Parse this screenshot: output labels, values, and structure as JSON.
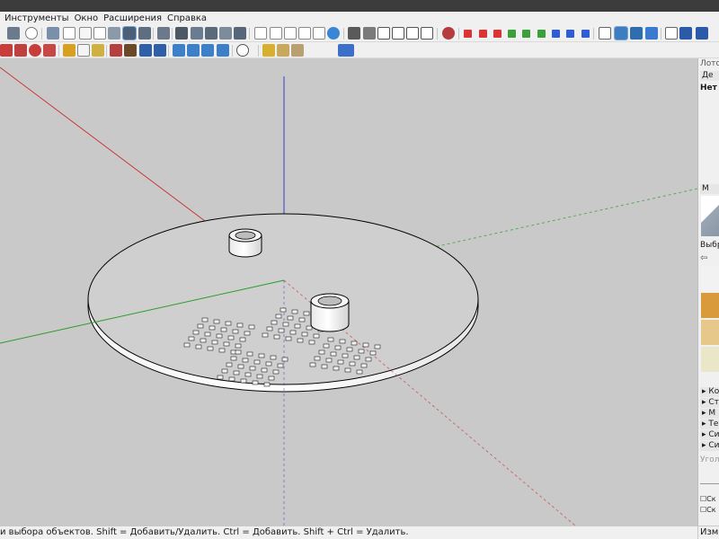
{
  "menu": [
    "Инструменты",
    "Окно",
    "Расширения",
    "Справка"
  ],
  "tray": {
    "title": "Лоток",
    "entity_info_header": "Де",
    "entity_info_value": "Нет",
    "materials_header": "М",
    "select_tab": "Выбра",
    "collapsed_panels": [
      "Ко",
      "Ст",
      "М",
      "Те",
      "Си",
      "Си"
    ],
    "angle_label": "Угол",
    "checkbox_labels": [
      "Ск",
      "Ск"
    ]
  },
  "materials": {
    "swatch_colors": [
      "#f2f2f2",
      "#d89a3a",
      "#e6c98a",
      "#eae7c8"
    ]
  },
  "status": {
    "text": "и выбора объектов. Shift = Добавить/Удалить. Ctrl = Добавить. Shift + Ctrl = Удалить.",
    "measure_label": "Измер"
  },
  "scene": {
    "background": "#c9c9c9",
    "axis_colors": {
      "red": "#c83c3c",
      "green": "#2a9d2a",
      "blue": "#3140c8"
    },
    "model_color": "#e4e4e4"
  }
}
